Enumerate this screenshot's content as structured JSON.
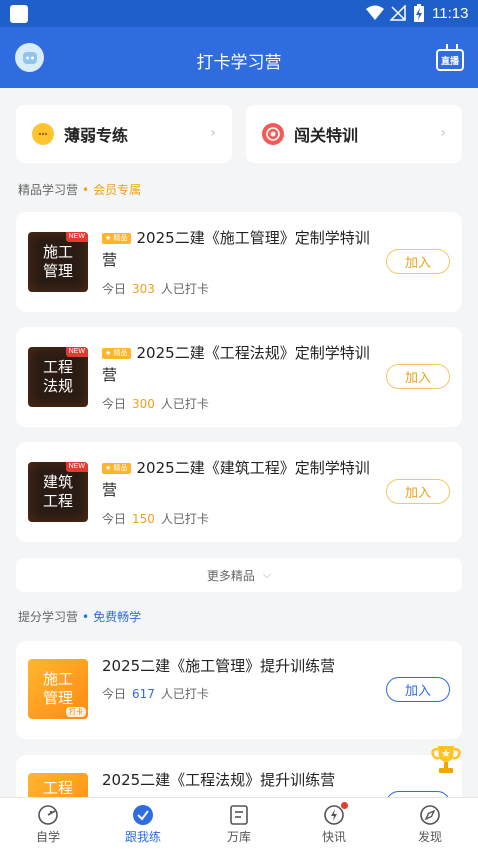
{
  "status_bar": {
    "time": "11:13"
  },
  "header": {
    "title": "打卡学习营",
    "live_label": "直播"
  },
  "quick_actions": [
    {
      "label": "薄弱专练",
      "icon": "chat-bubble-icon"
    },
    {
      "label": "闯关特训",
      "icon": "target-icon"
    }
  ],
  "premium_section": {
    "title": "精品学习营",
    "dot": "•",
    "tag": "会员专属"
  },
  "premium_camps": [
    {
      "thumb_line1": "施工",
      "thumb_line2": "管理",
      "new_tag": "NEW",
      "badge": "★ 精品",
      "title": "2025二建《施工管理》定制学特训营",
      "meta_prefix": "今日",
      "count": "303",
      "meta_suffix": "人已打卡",
      "join_label": "加入"
    },
    {
      "thumb_line1": "工程",
      "thumb_line2": "法规",
      "new_tag": "NEW",
      "badge": "★ 精品",
      "title": "2025二建《工程法规》定制学特训营",
      "meta_prefix": "今日",
      "count": "300",
      "meta_suffix": "人已打卡",
      "join_label": "加入"
    },
    {
      "thumb_line1": "建筑",
      "thumb_line2": "工程",
      "new_tag": "NEW",
      "badge": "★ 精品",
      "title": "2025二建《建筑工程》定制学特训营",
      "meta_prefix": "今日",
      "count": "150",
      "meta_suffix": "人已打卡",
      "join_label": "加入"
    }
  ],
  "more_button": {
    "label": "更多精品"
  },
  "free_section": {
    "title": "提分学习营",
    "dot": "•",
    "tag": "免费畅学"
  },
  "free_camps": [
    {
      "thumb_line1": "施工",
      "thumb_line2": "管理",
      "thumb_tag": "打卡",
      "title": "2025二建《施工管理》提升训练营",
      "meta_prefix": "今日",
      "count": "617",
      "meta_suffix": "人已打卡",
      "join_label": "加入"
    },
    {
      "thumb_line1": "工程",
      "thumb_line2": "",
      "thumb_tag": "",
      "title": "2025二建《工程法规》提升训练营",
      "meta_prefix": "",
      "count": "",
      "meta_suffix": "",
      "join_label": ""
    }
  ],
  "tabbar": [
    {
      "label": "自学",
      "icon": "self-study-icon",
      "active": false
    },
    {
      "label": "跟我练",
      "icon": "check-circle-icon",
      "active": true
    },
    {
      "label": "万库",
      "icon": "question-bank-icon",
      "active": false
    },
    {
      "label": "快讯",
      "icon": "lightning-icon",
      "active": false,
      "dot": true
    },
    {
      "label": "发现",
      "icon": "compass-icon",
      "active": false
    }
  ],
  "colors": {
    "primary": "#2f6ce0",
    "accent_orange": "#f0a020",
    "new_red": "#e53a2f"
  }
}
